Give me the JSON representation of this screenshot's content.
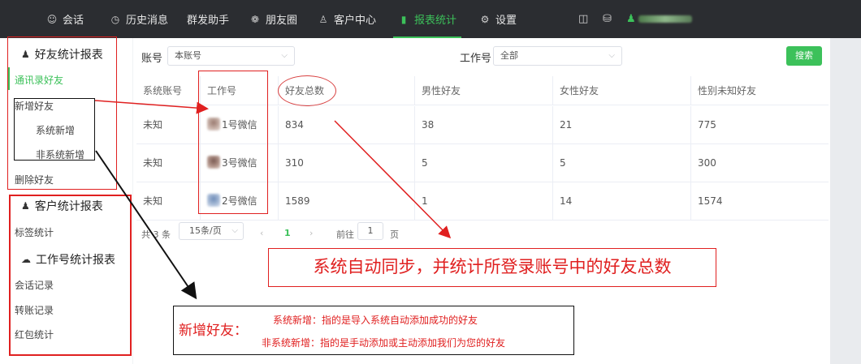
{
  "nav": {
    "items": [
      {
        "icon": "chat-icon",
        "glyph": "☺",
        "label": "会话"
      },
      {
        "icon": "clock-icon",
        "glyph": "◷",
        "label": "历史消息"
      },
      {
        "icon": "",
        "glyph": "",
        "label": "群发助手"
      },
      {
        "icon": "moments-icon",
        "glyph": "❁",
        "label": "朋友圈"
      },
      {
        "icon": "user-icon",
        "glyph": "♙",
        "label": "客户中心"
      },
      {
        "icon": "bar-chart-icon",
        "glyph": "▮",
        "label": "报表统计",
        "active": true
      },
      {
        "icon": "gear-icon",
        "glyph": "⚙",
        "label": "设置"
      }
    ],
    "accent": "#3cc15a"
  },
  "sidebar": {
    "friend_report": {
      "icon": "person-icon",
      "title": "好友统计报表"
    },
    "friend_items": [
      "通讯录好友",
      "新增好友",
      "系统新增",
      "非系统新增",
      "删除好友"
    ],
    "customer_report": {
      "icon": "person-icon",
      "title": "客户统计报表"
    },
    "customer_items": [
      "标签统计"
    ],
    "work_report": {
      "icon": "wechat-icon",
      "title": "工作号统计报表"
    },
    "work_items": [
      "会话记录",
      "转账记录",
      "红包统计"
    ]
  },
  "filters": {
    "account_label": "账号",
    "account_value": "本账号",
    "work_label": "工作号",
    "work_value": "全部",
    "search_label": "搜索"
  },
  "table": {
    "headers": [
      "系统账号",
      "工作号",
      "好友总数",
      "男性好友",
      "女性好友",
      "性别未知好友"
    ],
    "rows": [
      [
        "未知",
        "1号微信",
        "834",
        "38",
        "21",
        "775"
      ],
      [
        "未知",
        "3号微信",
        "310",
        "5",
        "5",
        "300"
      ],
      [
        "未知",
        "2号微信",
        "1589",
        "1",
        "14",
        "1574"
      ]
    ]
  },
  "pagination": {
    "total": "共 3 条",
    "page_size": "15条/页",
    "prev": "‹",
    "current": "1",
    "next": "›",
    "goto_prefix": "前往",
    "goto_value": "1",
    "goto_suffix": "页"
  },
  "annotations": {
    "main_note": "系统自动同步，并统计所登录账号中的好友总数",
    "new_friend_title": "新增好友：",
    "system_new": "系统新增：指的是导入系统自动添加成功的好友",
    "non_system_new": "非系统新增：指的是手动添加或主动添加我们为您的好友"
  }
}
